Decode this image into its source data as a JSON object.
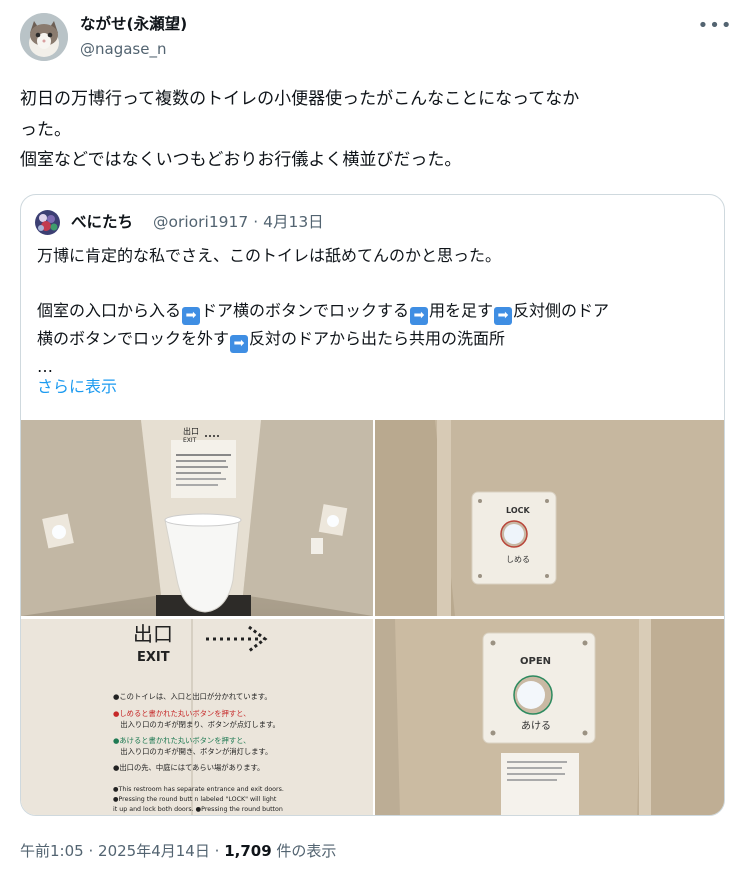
{
  "tweet": {
    "author_name": "ながせ(永瀬望)",
    "author_handle": "@nagase_n",
    "more_icon": "more-horizontal-icon",
    "text_lines": [
      "初日の万博行って複数のトイレの小便器使ったがこんなことになってなか",
      "った。",
      "個室などではなくいつもどおりお行儀よく横並びだった。"
    ],
    "time": "午前1:05",
    "separator": "·",
    "date": "2025年4月14日",
    "views_count": "1,709",
    "views_label": "件の表示"
  },
  "quote": {
    "author_name": "べにたち",
    "author_handle": "@oriori1917",
    "separator": "·",
    "date": "4月13日",
    "line1": "万博に肯定的な私でさえ、このトイレは舐めてんのかと思った。",
    "line2_segments": [
      "個室の入口から入る",
      "ドア横のボタンでロックする",
      "用を足す",
      "反対側のドア"
    ],
    "line3_segments": [
      "横のボタンでロックを外す",
      "反対のドアから出たら共用の洗面所"
    ],
    "ellipsis": "…",
    "arrow_glyph": "➡",
    "show_more": "さらに表示"
  },
  "photos": {
    "p1": {
      "sign_title": "出口",
      "sign_sub": "EXIT"
    },
    "p2": {
      "lock_label": "LOCK",
      "lock_sub": "しめる"
    },
    "p3": {
      "sign_title": "出口",
      "sign_sub": "EXIT",
      "ja_lines": [
        "●このトイレは、入口と出口が分かれています。",
        "●しめると書かれた丸いボタンを押すと、",
        "　出入り口のカギが閉まり、ボタンが点灯します。",
        "●あけると書かれた丸いボタンを押すと、",
        "　出入り口のカギが開き、ボタンが消灯します。",
        "●出口の先、中庭にはてあらい場があります。"
      ],
      "en_lines": [
        "●This restroom has separate entrance and exit doors.",
        "●Pressing the round butt n labeled \"LOCK\" will light",
        "  it up and lock both doors. ●Pressing the round button"
      ]
    },
    "p4": {
      "open_label": "OPEN",
      "open_sub": "あける"
    }
  }
}
